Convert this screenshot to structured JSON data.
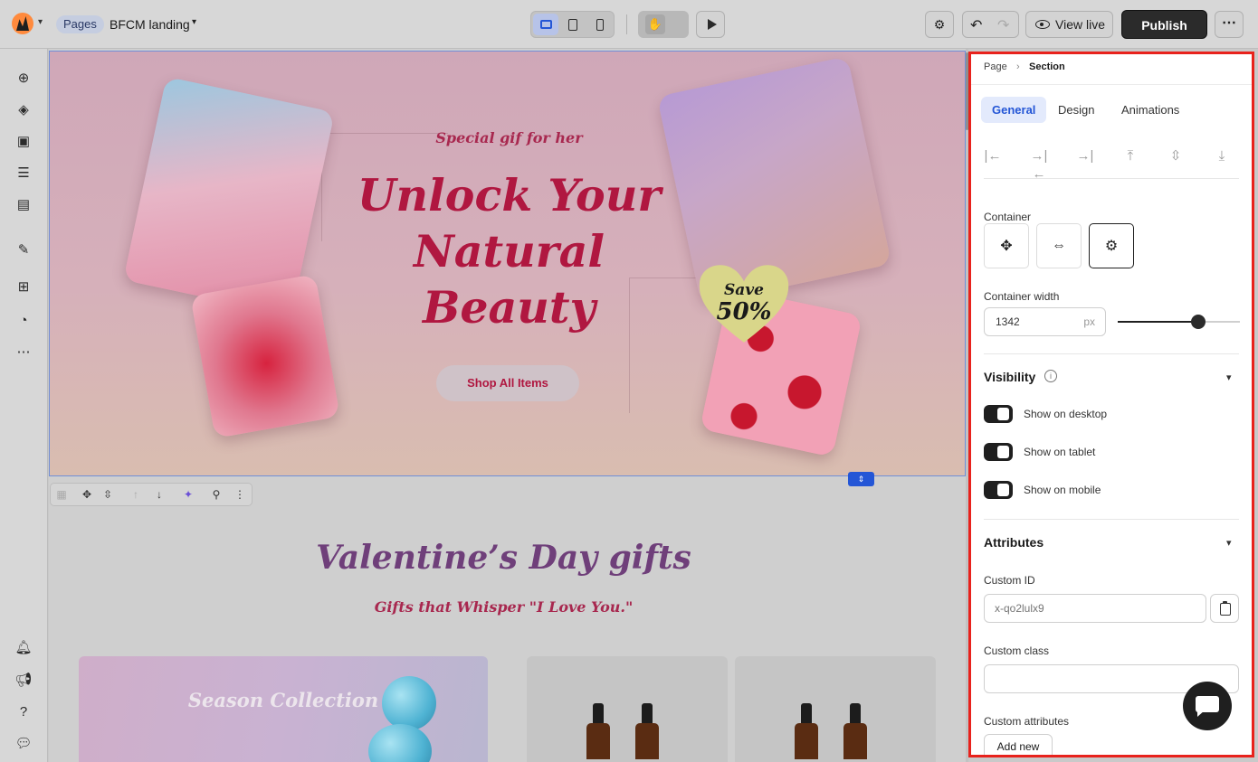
{
  "topbar": {
    "pages_badge": "Pages",
    "page_name": "BFCM landing",
    "view_live": "View live",
    "publish": "Publish"
  },
  "hero": {
    "subtitle": "Special gif for her",
    "title_line1": "Unlock Your",
    "title_line2": "Natural",
    "title_line3": "Beauty",
    "cta": "Shop All Items",
    "badge_line1": "Save",
    "badge_line2": "50%"
  },
  "valentine": {
    "title": "Valentine’s Day gifts",
    "subtitle": "Gifts that Whisper \"I Love You.\"",
    "season_card": "Season Collection"
  },
  "panel": {
    "breadcrumb_root": "Page",
    "breadcrumb_current": "Section",
    "tabs": [
      "General",
      "Design",
      "Animations"
    ],
    "container_label": "Container",
    "container_width_label": "Container width",
    "container_width_value": "1342",
    "container_width_unit": "px",
    "container_width_fraction": 0.66,
    "visibility": {
      "title": "Visibility",
      "items": [
        "Show on desktop",
        "Show on tablet",
        "Show on mobile"
      ]
    },
    "attributes": {
      "title": "Attributes",
      "custom_id_label": "Custom ID",
      "custom_id_placeholder": "x-qo2lulx9",
      "custom_class_label": "Custom class",
      "custom_attributes_label": "Custom attributes",
      "add_new": "Add new"
    }
  },
  "colors": {
    "accent": "#2456d6",
    "hero_text": "#b01740",
    "highlight_border": "#e8221c",
    "publish_bg": "#2b2b2b"
  }
}
